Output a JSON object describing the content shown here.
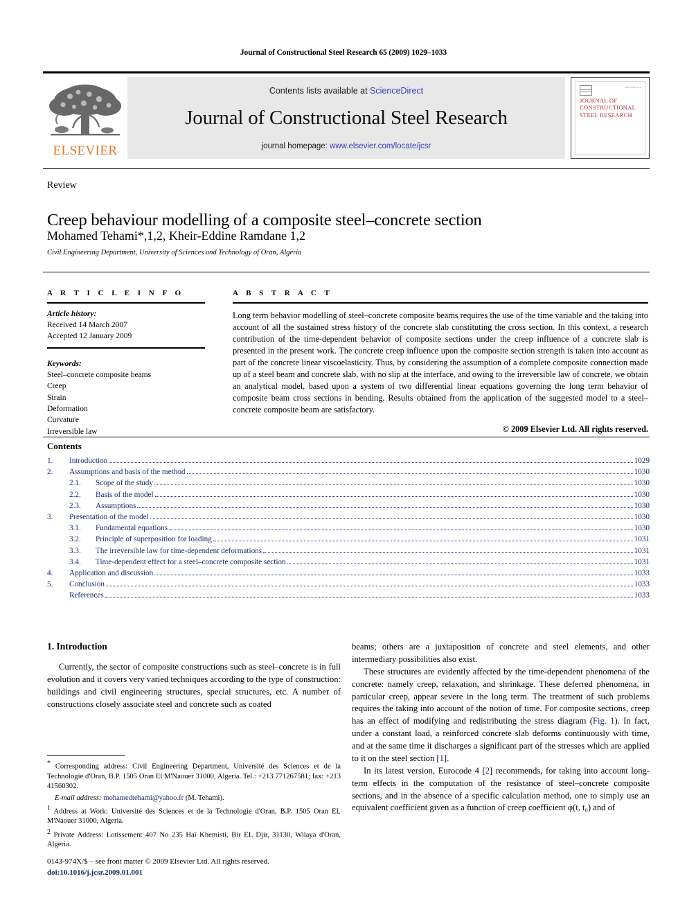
{
  "running_head": "Journal of Constructional Steel Research 65 (2009) 1029–1033",
  "masthead": {
    "elsevier_wordmark": "ELSEVIER",
    "contents_prefix": "Contents lists available at ",
    "sciencedirect": "ScienceDirect",
    "journal_name": "Journal of Constructional Steel Research",
    "homepage_prefix": "journal homepage: ",
    "homepage_url": "www.elsevier.com/locate/jcsr",
    "cover_title": "JOURNAL OF CONSTRUCTIONAL STEEL RESEARCH",
    "cover_corner_text": "ISSN 0143-974X"
  },
  "article": {
    "doctype": "Review",
    "title": "Creep behaviour modelling of a composite steel–concrete section",
    "authors": "Mohamed Tehami*,1,2, Kheir-Eddine Ramdane 1,2",
    "affiliation": "Civil Engineering Department, University of Sciences and Technology of Oran, Algeria"
  },
  "info": {
    "header": "A R T I C L E   I N F O",
    "history_label": "Article history:",
    "history": [
      "Received 14 March 2007",
      "Accepted 12 January 2009"
    ],
    "keywords_label": "Keywords:",
    "keywords": [
      "Steel–concrete composite beams",
      "Creep",
      "Strain",
      "Deformation",
      "Curvature",
      "Irreversible law"
    ]
  },
  "abstract": {
    "header": "A B S T R A C T",
    "text": "Long term behavior modelling of steel–concrete composite beams requires the use of the time variable and the taking into account of all the sustained stress history of the concrete slab constituting the cross section. In this context, a research contribution of the time-dependent behavior of composite sections under the creep influence of a concrete slab is presented in the present work. The concrete creep influence upon the composite section strength is taken into account as part of the concrete linear viscoelasticity. Thus, by considering the assumption of a complete composite connection made up of a steel beam and concrete slab, with no slip at the interface, and owing to the irreversible law of concrete, we obtain an analytical model, based upon a system of two differential linear equations governing the long term behavior of composite beam cross sections in bending. Results obtained from the application of the suggested model to a steel–concrete composite beam are satisfactory.",
    "copyright": "© 2009 Elsevier Ltd. All rights reserved."
  },
  "contents": {
    "header": "Contents",
    "entries": [
      {
        "num": "1.",
        "level": 1,
        "label": "Introduction",
        "page": "1029"
      },
      {
        "num": "2.",
        "level": 1,
        "label": "Assumptions and basis of the method",
        "page": "1030"
      },
      {
        "num": "2.1.",
        "level": 2,
        "label": "Scope of the study",
        "page": "1030"
      },
      {
        "num": "2.2.",
        "level": 2,
        "label": "Basis of the model",
        "page": "1030"
      },
      {
        "num": "2.3.",
        "level": 2,
        "label": "Assumptions",
        "page": "1030"
      },
      {
        "num": "3.",
        "level": 1,
        "label": "Presentation of the model",
        "page": "1030"
      },
      {
        "num": "3.1.",
        "level": 2,
        "label": "Fundamental equations",
        "page": "1030"
      },
      {
        "num": "3.2.",
        "level": 2,
        "label": "Principle of superposition for loading",
        "page": "1031"
      },
      {
        "num": "3.3.",
        "level": 2,
        "label": "The irreversible law for time-dependent deformations",
        "page": "1031"
      },
      {
        "num": "3.4.",
        "level": 2,
        "label": "Time-dependent effect for a steel–concrete composite section",
        "page": "1031"
      },
      {
        "num": "4.",
        "level": 1,
        "label": "Application and discussion",
        "page": "1033"
      },
      {
        "num": "5.",
        "level": 1,
        "label": "Conclusion",
        "page": "1033"
      },
      {
        "num": "",
        "level": 0,
        "label": "References",
        "page": "1033"
      }
    ]
  },
  "body": {
    "section_heading": "1. Introduction",
    "left_para_1": "Currently, the sector of composite constructions such as steel–concrete is in full evolution and it covers very varied techniques according to the type of construction: buildings and civil engineering structures, special structures, etc. A number of constructions closely associate steel and concrete such as coated",
    "right_para_1": "beams; others are a juxtaposition of concrete and steel elements, and other intermediary possibilities also exist.",
    "right_para_2_a": "These structures are evidently affected by the time-dependent phenomena of the concrete: namely creep, relaxation, and shrinkage. These deferred phenomena, in particular creep, appear severe in the long term. The treatment of such problems requires the taking into account of the notion of time. For composite sections, creep has an effect of modifying and redistributing the stress diagram (",
    "right_para_2_link": "Fig. 1",
    "right_para_2_b": "). In fact, under a constant load, a reinforced concrete slab deforms continuously with time, and at the same time it discharges a significant part of the stresses which are applied to it on the steel section [",
    "right_para_2_ref": "1",
    "right_para_2_c": "].",
    "right_para_3_a": "In its latest version, Eurocode 4 [",
    "right_para_3_ref": "2",
    "right_para_3_b": "] recommends, for taking into account long-term effects in the computation of the resistance of steel–concrete composite sections, and in the absence of a specific calculation method, one to simply use an equivalent coefficient given as a function of creep coefficient φ(t, t₀) and of"
  },
  "footnotes": {
    "corresponding": "Corresponding address: Civil Engineering Department, Université des Sciences et de la Technologie d'Oran, B.P. 1505 Oran El M'Naouer 31000, Algeria. Tel.: +213 771267581; fax: +213 41560302.",
    "corresponding_mark": "*",
    "email_label": "E-mail address:",
    "email": "mohamedtehami@yahoo.fr",
    "email_suffix": " (M. Tehami).",
    "fn1_mark": "1",
    "fn1": "Address at Work: Université des Sciences et de la Technologie d'Oran, B.P. 1505 Oran EL M'Naouer 31000, Algeria.",
    "fn2_mark": "2",
    "fn2": "Private Address: Lotissement 407 No 235 Haï Khemisti, Bir EL Djir, 31130, Wilaya d'Oran, Algeria."
  },
  "imprint": {
    "issn_line": "0143-974X/$ – see front matter © 2009 Elsevier Ltd. All rights reserved.",
    "doi": "doi:10.1016/j.jcsr.2009.01.001"
  },
  "colors": {
    "elsevier_orange": "#E87722",
    "link_blue": "#3b3bbf",
    "toc_blue": "#1c2a6b",
    "cover_red": "#b5293a",
    "band_gray": "#e8e8e8"
  }
}
